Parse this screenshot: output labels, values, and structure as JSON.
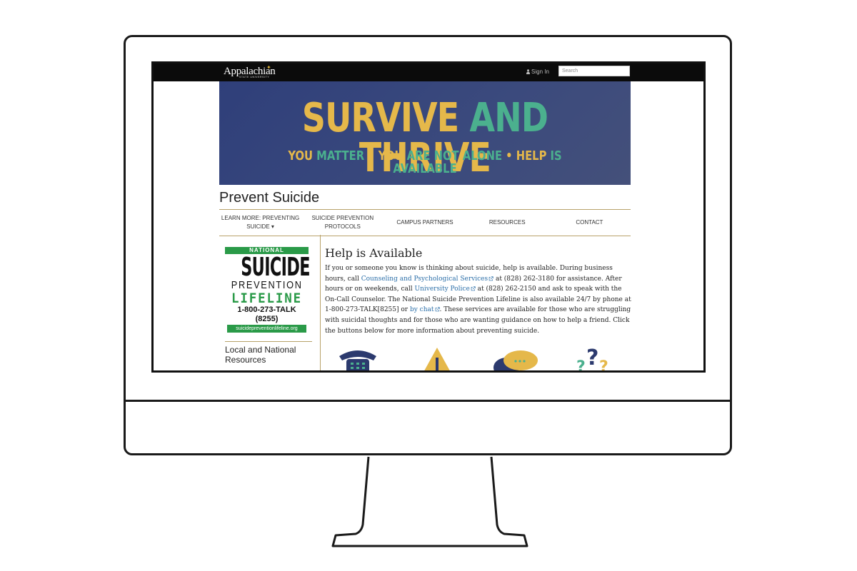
{
  "topbar": {
    "logo": "Appalachian",
    "logo_sub": "STATE UNIVERSITY",
    "signin_label": "Sign In",
    "search_placeholder": "Search"
  },
  "banner": {
    "title_part1": "SURVIVE ",
    "title_part2": "AND ",
    "title_part3": "THRIVE",
    "sub": [
      {
        "text": "YOU ",
        "color": "gold"
      },
      {
        "text": "MATTER",
        "color": "green"
      },
      {
        "text": " • YOU ",
        "color": "gold"
      },
      {
        "text": "ARE NOT ALONE",
        "color": "green"
      },
      {
        "text": " • HELP ",
        "color": "gold"
      },
      {
        "text": "IS AVAILABLE",
        "color": "green"
      }
    ]
  },
  "page_title": "Prevent Suicide",
  "nav": {
    "items": [
      {
        "line1": "LEARN MORE: PREVENTING",
        "line2": "SUICIDE ▾"
      },
      {
        "line1": "SUICIDE PREVENTION",
        "line2": "PROTOCOLS"
      },
      {
        "line1": "CAMPUS PARTNERS",
        "line2": ""
      },
      {
        "line1": "RESOURCES",
        "line2": ""
      },
      {
        "line1": "CONTACT",
        "line2": ""
      }
    ]
  },
  "sidebar": {
    "lifeline": {
      "national": "NATIONAL",
      "suicide": "SUICIDE",
      "prevention": "PREVENTION",
      "lifeline": "LIFELINE",
      "tm": "TM",
      "phone": "1-800-273-TALK (8255)",
      "url": "suicidepreventionlifeline.org"
    },
    "heading": "Local and National Resources"
  },
  "main": {
    "heading": "Help is Available",
    "p1": "If you or someone you know is thinking about suicide, help is available. During business hours, call ",
    "link1": "Counseling and Psychological Services",
    "p2": " at (828) 262-3180 for assistance. After hours or on weekends, call ",
    "link2": "University Police",
    "p3": " at (828) 262-2150 and ask to speak with the On-Call Counselor. The National Suicide Prevention Lifeline is also available 24/7 by phone at 1-800-273-TALK[8255] or ",
    "link3": "by chat",
    "p4": ". These services are available for those who are struggling with suicidal thoughts and for those who are wanting guidance on how to help a friend. Click the buttons below for more information about preventing suicide."
  },
  "colors": {
    "gold": "#e5b84a",
    "green": "#4bb08e",
    "navy": "#2f3f7a",
    "lifeline_green": "#2a9a48",
    "link": "#2a6ea8",
    "rule": "#b8a26a"
  },
  "icons": [
    "user-icon",
    "external-link-icon",
    "telephone-icon",
    "warning-icon",
    "chat-bubbles-icon",
    "question-marks-icon"
  ]
}
